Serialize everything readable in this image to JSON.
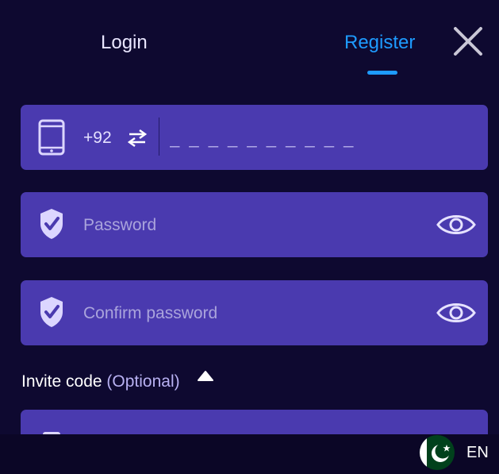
{
  "tabs": {
    "login_label": "Login",
    "register_label": "Register",
    "active": "Register"
  },
  "phone": {
    "country_code": "+92",
    "placeholder": "_ _ _ _ _ _ _ _ _ _",
    "value": ""
  },
  "password": {
    "placeholder": "Password",
    "value": ""
  },
  "confirm_password": {
    "placeholder": "Confirm password",
    "value": ""
  },
  "invite": {
    "label": "Invite code",
    "optional": "(Optional)"
  },
  "footer": {
    "language": "EN"
  },
  "colors": {
    "background": "#0e0930",
    "field": "#4a3aaf",
    "accent": "#1e9bff",
    "icon": "#dcd6ff"
  }
}
